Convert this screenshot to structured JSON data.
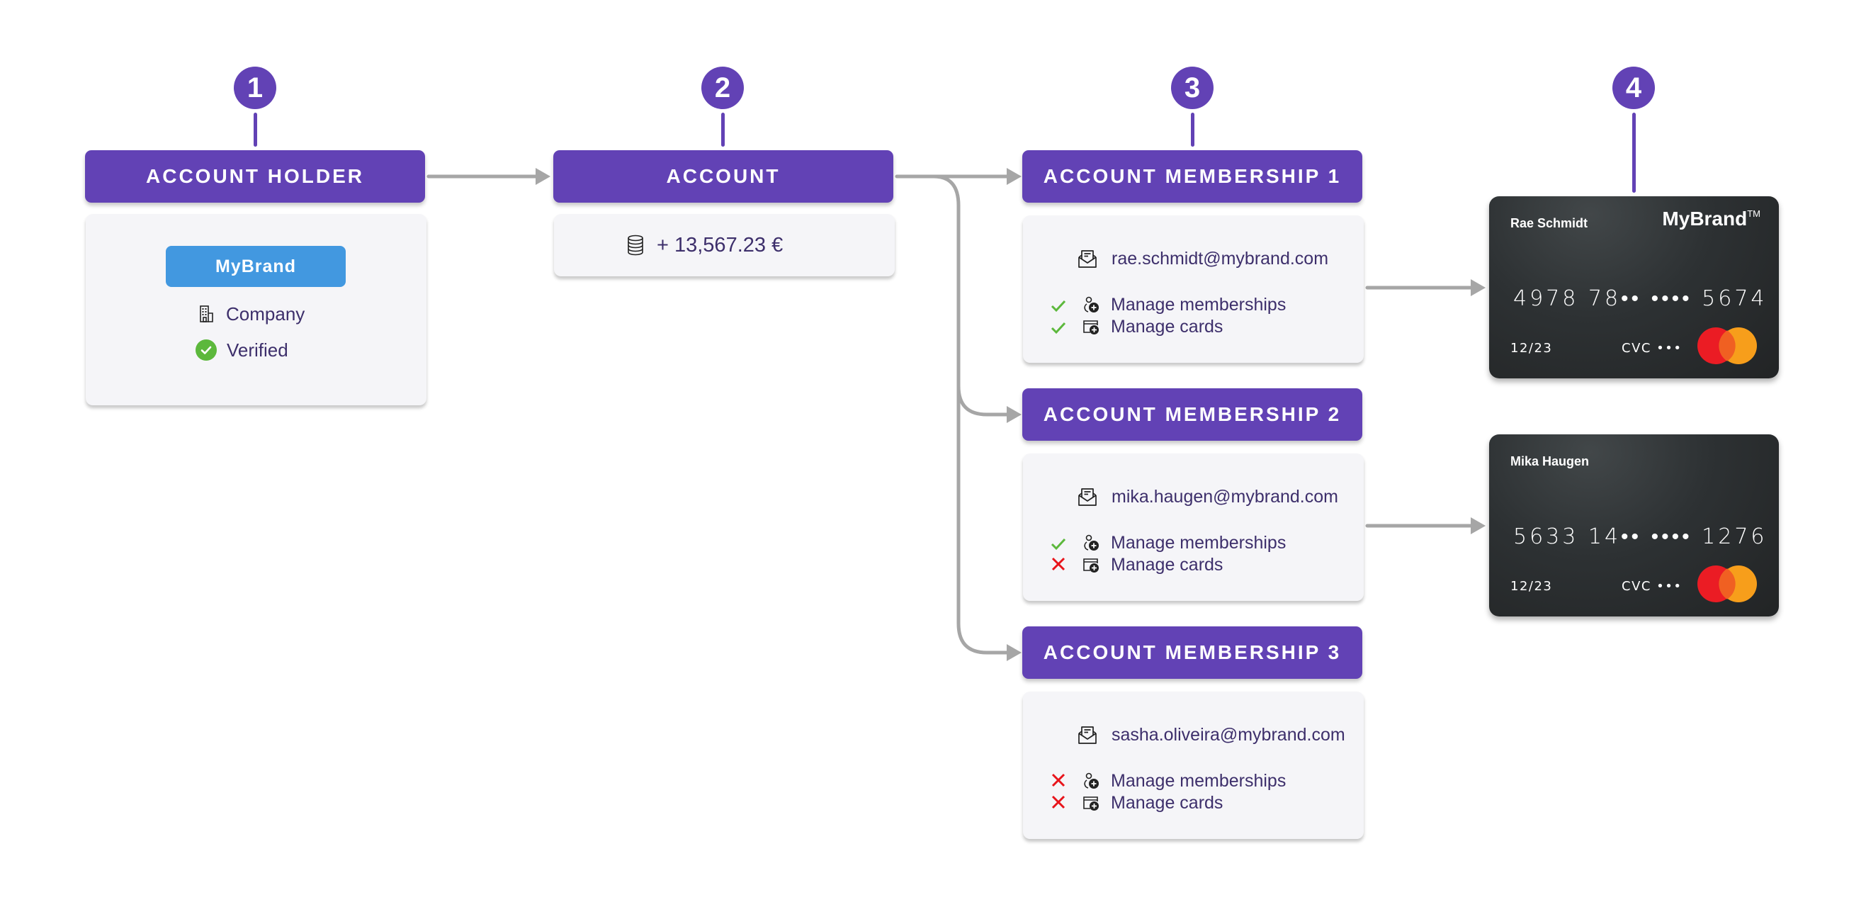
{
  "colors": {
    "primary": "#6242b5",
    "brand_button": "#4298e0",
    "connector": "#a6a6a6",
    "allowed": "#5cb83c",
    "denied": "#e8141b",
    "text": "#3d2f6b",
    "card_dark": "#2d3133"
  },
  "steps": [
    {
      "number": "1",
      "title": "ACCOUNT HOLDER"
    },
    {
      "number": "2",
      "title": "ACCOUNT"
    },
    {
      "number": "3",
      "title": "ACCOUNT MEMBERSHIP 1"
    },
    {
      "number": "4"
    }
  ],
  "account_holder": {
    "title": "ACCOUNT HOLDER",
    "brand": "MyBrand",
    "type_icon": "building-icon",
    "type": "Company",
    "status_icon": "verified-check-icon",
    "status": "Verified"
  },
  "account": {
    "title": "ACCOUNT",
    "balance_icon": "coins-stack-icon",
    "balance": "+ 13,567.23 €"
  },
  "memberships": [
    {
      "title": "ACCOUNT MEMBERSHIP 1",
      "email": "rae.schmidt@mybrand.com",
      "permissions": [
        {
          "label": "Manage memberships",
          "allowed": true,
          "icon": "user-add-icon"
        },
        {
          "label": "Manage cards",
          "allowed": true,
          "icon": "card-add-icon"
        }
      ]
    },
    {
      "title": "ACCOUNT MEMBERSHIP 2",
      "email": "mika.haugen@mybrand.com",
      "permissions": [
        {
          "label": "Manage memberships",
          "allowed": true,
          "icon": "user-add-icon"
        },
        {
          "label": "Manage cards",
          "allowed": false,
          "icon": "card-add-icon"
        }
      ]
    },
    {
      "title": "ACCOUNT MEMBERSHIP 3",
      "email": "sasha.oliveira@mybrand.com",
      "permissions": [
        {
          "label": "Manage memberships",
          "allowed": false,
          "icon": "user-add-icon"
        },
        {
          "label": "Manage cards",
          "allowed": false,
          "icon": "card-add-icon"
        }
      ]
    }
  ],
  "cards": [
    {
      "holder": "Rae Schmidt",
      "brand": "MyBrand",
      "brand_mark": "TM",
      "number": "4978 78•• •••• 5674",
      "expiry": "12/23",
      "cvc": "CVC •••",
      "network": "mastercard"
    },
    {
      "holder": "Mika Haugen",
      "brand": "",
      "brand_mark": "",
      "number": "5633 14•• •••• 1276",
      "expiry": "12/23",
      "cvc": "CVC •••",
      "network": "mastercard"
    }
  ]
}
